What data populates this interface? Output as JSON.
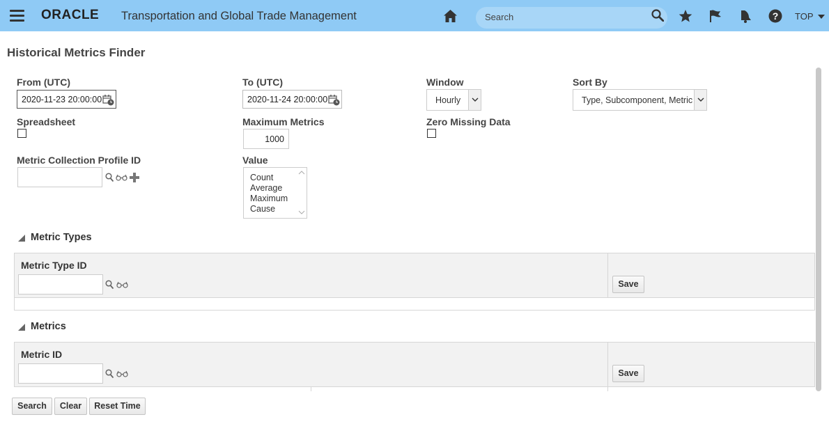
{
  "header": {
    "brand": "ORACLE",
    "app_title": "Transportation and Global Trade Management",
    "search_placeholder": "Search",
    "top_label": "TOP",
    "icons": [
      "menu-icon",
      "home-icon",
      "search-icon",
      "star-icon",
      "flag-icon",
      "bell-icon",
      "help-icon"
    ]
  },
  "page": {
    "title": "Historical Metrics Finder"
  },
  "form": {
    "from_label": "From (UTC)",
    "from_value": "2020-11-23 20:00:00",
    "to_label": "To (UTC)",
    "to_value": "2020-11-24 20:00:00",
    "window_label": "Window",
    "window_value": "Hourly",
    "sort_label": "Sort By",
    "sort_value": "Type, Subcomponent, Metric",
    "spreadsheet_label": "Spreadsheet",
    "spreadsheet_checked": false,
    "max_metrics_label": "Maximum Metrics",
    "max_metrics_value": "1000",
    "zero_missing_label": "Zero Missing Data",
    "zero_missing_checked": false,
    "profile_label": "Metric Collection Profile ID",
    "profile_value": "",
    "value_label": "Value",
    "value_options": [
      "Count",
      "Average",
      "Maximum",
      "Cause"
    ]
  },
  "metric_types": {
    "section_title": "Metric Types",
    "column_label": "Metric Type ID",
    "input_value": "",
    "save_label": "Save"
  },
  "metrics": {
    "section_title": "Metrics",
    "column_label": "Metric ID",
    "input_value": "",
    "save_label": "Save"
  },
  "footer_buttons": {
    "search": "Search",
    "clear": "Clear",
    "reset_time": "Reset Time"
  },
  "colors": {
    "header_bg": "#8fcaf5",
    "search_bg": "#a8d6f7"
  }
}
